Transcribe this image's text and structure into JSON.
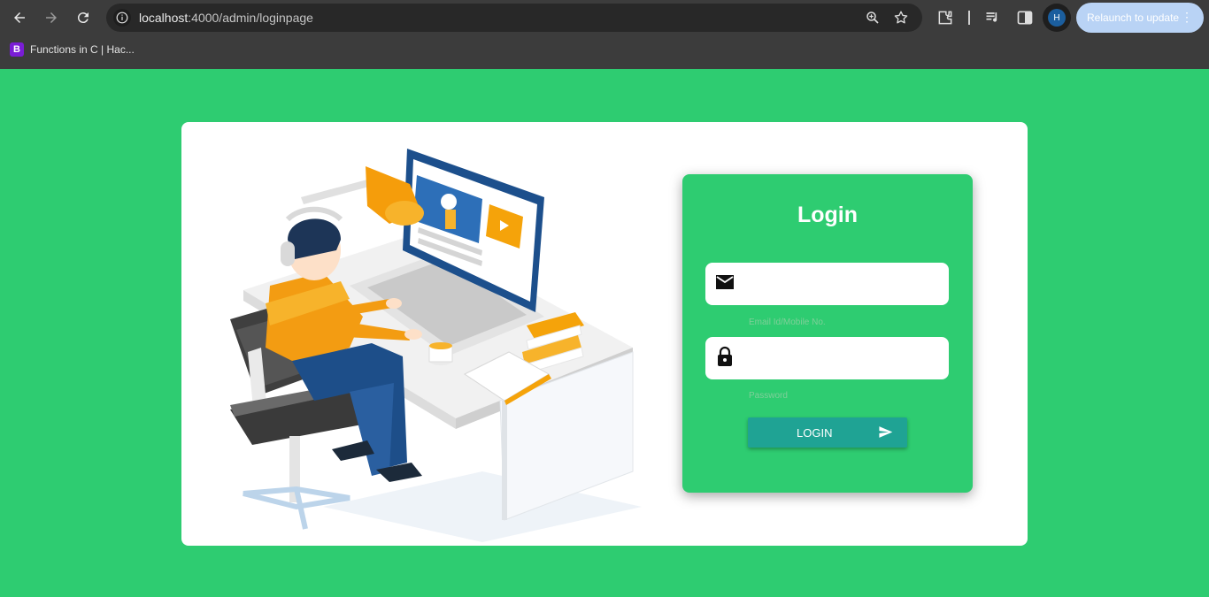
{
  "browser": {
    "url_host": "localhost",
    "url_rest": ":4000/admin/loginpage",
    "profile_initial": "H",
    "relaunch_label": "Relaunch to update",
    "bookmark": {
      "icon_letter": "B",
      "label": "Functions in C | Hac..."
    }
  },
  "login": {
    "title": "Login",
    "email_placeholder": "Email Id/Mobile No.",
    "password_placeholder": "Password",
    "button_label": "LOGIN"
  },
  "colors": {
    "page_background": "#2ecc71",
    "panel_background": "#2ecc71",
    "button_background": "#1fa394"
  }
}
